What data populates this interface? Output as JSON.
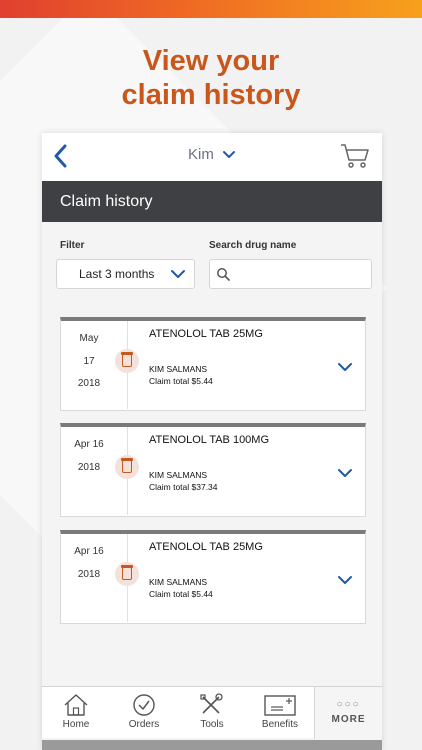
{
  "promo": {
    "headline_line1": "View your",
    "headline_line2": "claim history"
  },
  "appbar": {
    "user_name": "Kim"
  },
  "page_title": "Claim history",
  "filter": {
    "label": "Filter",
    "value": "Last 3 months"
  },
  "search": {
    "label": "Search drug name",
    "placeholder": ""
  },
  "claims": [
    {
      "date_line1": "May",
      "date_line2": "17",
      "date_line3": "2018",
      "drug": "ATENOLOL TAB 25MG",
      "patient": "KIM SALMANS",
      "total": "Claim total $5.44"
    },
    {
      "date_line1": "Apr 16",
      "date_line2": "",
      "date_line3": "2018",
      "drug": "ATENOLOL TAB 100MG",
      "patient": "KIM SALMANS",
      "total": "Claim total $37.34"
    },
    {
      "date_line1": "Apr 16",
      "date_line2": "",
      "date_line3": "2018",
      "drug": "ATENOLOL TAB 25MG",
      "patient": "KIM SALMANS",
      "total": "Claim total $5.44"
    }
  ],
  "tabbar": {
    "home": "Home",
    "orders": "Orders",
    "tools": "Tools",
    "benefits": "Benefits",
    "more": "MORE",
    "more_dots": "○○○"
  },
  "colors": {
    "accent": "#c9561b",
    "link_blue": "#1f5aa6",
    "titlebar": "#3f4043"
  }
}
